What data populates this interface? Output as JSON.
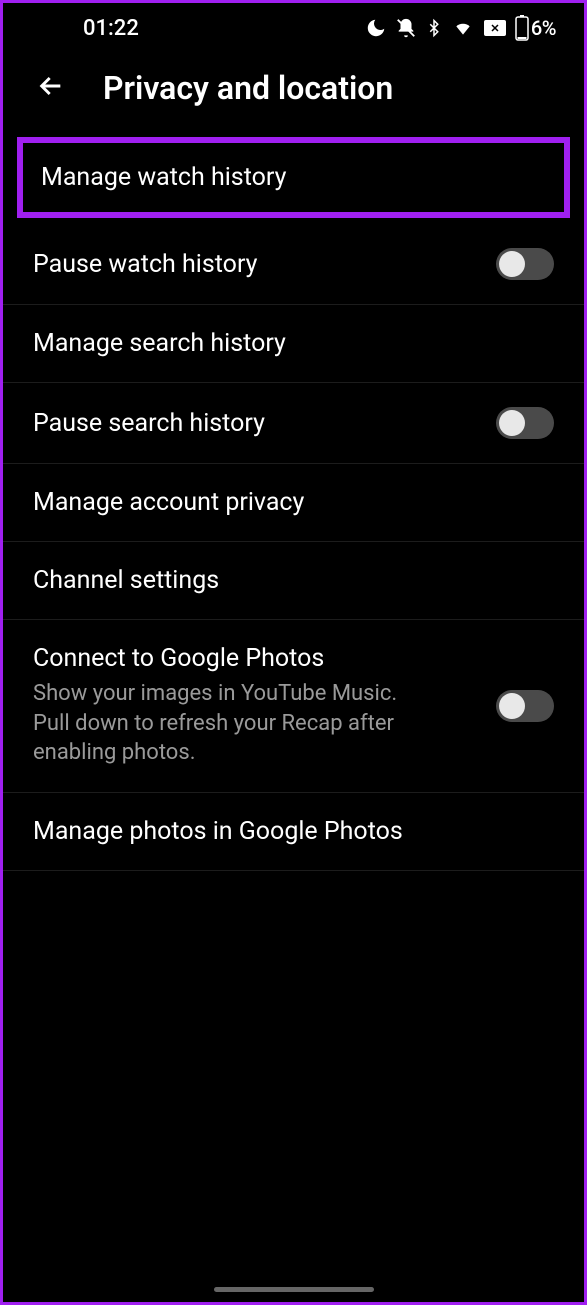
{
  "status": {
    "time": "01:22",
    "battery": "6%"
  },
  "header": {
    "title": "Privacy and location"
  },
  "items": {
    "manage_watch": "Manage watch history",
    "pause_watch": "Pause watch history",
    "manage_search": "Manage search history",
    "pause_search": "Pause search history",
    "manage_account": "Manage account privacy",
    "channel": "Channel settings",
    "connect_photos_title": "Connect to Google Photos",
    "connect_photos_sub": "Show your images in YouTube Music. Pull down to refresh your Recap after enabling photos.",
    "manage_photos": "Manage photos in Google Photos"
  },
  "toggles": {
    "pause_watch": false,
    "pause_search": false,
    "connect_photos": false
  }
}
